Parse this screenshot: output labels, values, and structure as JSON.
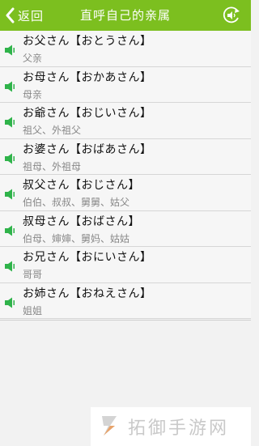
{
  "colors": {
    "accent": "#7cbf1f",
    "speaker_green": "#2fb34a",
    "reading_gray": "#888888"
  },
  "header": {
    "back_label": "返回",
    "title": "直呼自己的亲属",
    "back_icon": "chevron-left-icon",
    "play_icon": "replay-audio-icon"
  },
  "items": [
    {
      "jp": "お父さん【おとうさん】",
      "cn": "父亲"
    },
    {
      "jp": "お母さん【おかあさん】",
      "cn": "母亲"
    },
    {
      "jp": "お爺さん【おじいさん】",
      "cn": "祖父、外祖父"
    },
    {
      "jp": "お婆さん【おばあさん】",
      "cn": "祖母、外祖母"
    },
    {
      "jp": "叔父さん【おじさん】",
      "cn": "伯伯、叔叔、舅舅、姑父"
    },
    {
      "jp": "叔母さん【おばさん】",
      "cn": "伯母、婶婶、舅妈、姑姑"
    },
    {
      "jp": "お兄さん【おにいさん】",
      "cn": "哥哥"
    },
    {
      "jp": "お姉さん【おねえさん】",
      "cn": "姐姐"
    }
  ],
  "watermark": {
    "text": "拓御手游网"
  }
}
